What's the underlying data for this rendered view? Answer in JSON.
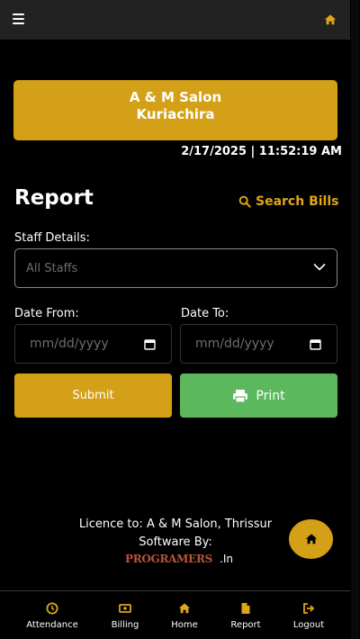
{
  "salon": {
    "name": "A & M Salon",
    "branch": "Kuriachira"
  },
  "datetime": "2/17/2025 | 11:52:19 AM",
  "page": {
    "title": "Report",
    "search_label": "Search Bills"
  },
  "form": {
    "staff_label": "Staff Details:",
    "staff_value": "All Staffs",
    "date_from_label": "Date From:",
    "date_to_label": "Date To:",
    "date_placeholder": "mm/dd/yyyy",
    "submit_label": "Submit",
    "print_label": "Print"
  },
  "footer": {
    "licence": "Licence to: A & M Salon, Thrissur",
    "software_by": "Software By:",
    "brand": "PROGRAMERS",
    "brand_ext": ".In"
  },
  "nav": {
    "attendance": "Attendance",
    "billing": "Billing",
    "home": "Home",
    "report": "Report",
    "logout": "Logout"
  },
  "colors": {
    "accent": "#d4a017",
    "print": "#5cb85c",
    "search": "#e0a616",
    "brand": "#b6553a"
  }
}
